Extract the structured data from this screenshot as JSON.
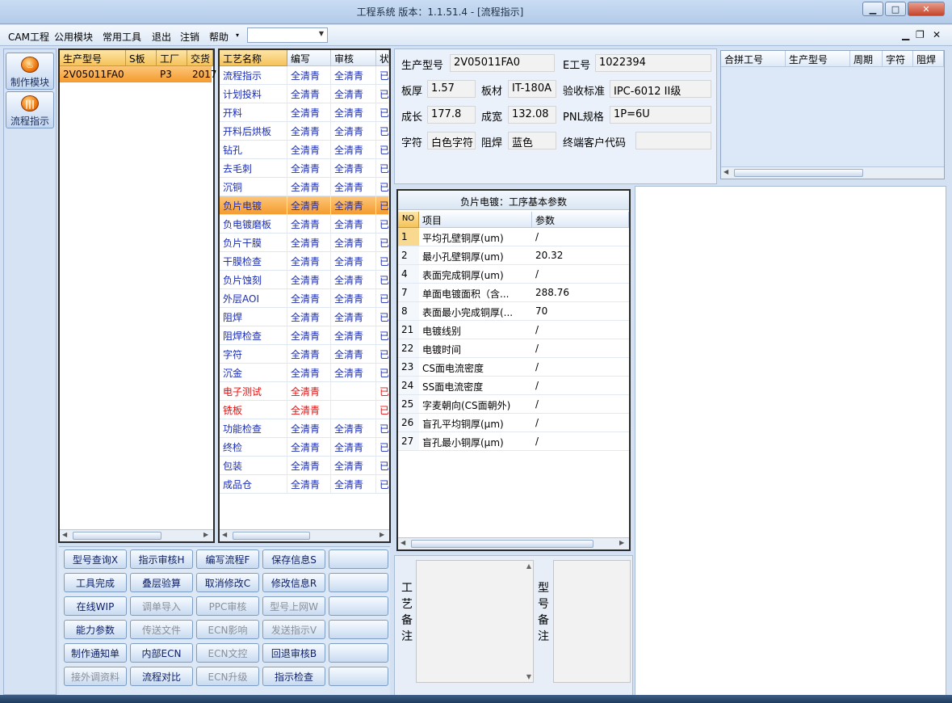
{
  "window": {
    "title": "工程系统   版本：1.1.51.4 - [流程指示]",
    "min_label": "▁",
    "max_label": "□",
    "close_label": "✕"
  },
  "menu": {
    "items": [
      "CAM工程",
      "公用模块",
      "常用工具",
      "退出",
      "注销",
      "帮助"
    ],
    "help_arrow": "▾",
    "combo_value": "",
    "mdi_min": "▁",
    "mdi_restore": "❐",
    "mdi_close": "✕"
  },
  "leftnav": {
    "items": [
      {
        "label": "制作模块",
        "icon": "fire-icon"
      },
      {
        "label": "流程指示",
        "icon": "bars-icon"
      }
    ]
  },
  "model_grid": {
    "headers": [
      "生产型号",
      "S板",
      "工厂",
      "交货"
    ],
    "rows": [
      [
        "2V05011FA0",
        "",
        "P3",
        "2017"
      ]
    ]
  },
  "process_grid": {
    "headers": [
      "工艺名称",
      "编写",
      "审核",
      "状"
    ],
    "selected": "负片电镀",
    "rows": [
      {
        "name": "流程指示",
        "write": "全清青",
        "review": "全清青",
        "status": "已",
        "red": false
      },
      {
        "name": "计划投料",
        "write": "全清青",
        "review": "全清青",
        "status": "已",
        "red": false
      },
      {
        "name": "开料",
        "write": "全清青",
        "review": "全清青",
        "status": "已",
        "red": false
      },
      {
        "name": "开料后烘板",
        "write": "全清青",
        "review": "全清青",
        "status": "已",
        "red": false
      },
      {
        "name": "钻孔",
        "write": "全清青",
        "review": "全清青",
        "status": "已",
        "red": false
      },
      {
        "name": "去毛刺",
        "write": "全清青",
        "review": "全清青",
        "status": "已",
        "red": false
      },
      {
        "name": "沉铜",
        "write": "全清青",
        "review": "全清青",
        "status": "已",
        "red": false
      },
      {
        "name": "负片电镀",
        "write": "全清青",
        "review": "全清青",
        "status": "已",
        "red": false
      },
      {
        "name": "负电镀磨板",
        "write": "全清青",
        "review": "全清青",
        "status": "已",
        "red": false
      },
      {
        "name": "负片干膜",
        "write": "全清青",
        "review": "全清青",
        "status": "已",
        "red": false
      },
      {
        "name": "干膜检查",
        "write": "全清青",
        "review": "全清青",
        "status": "已",
        "red": false
      },
      {
        "name": "负片蚀刻",
        "write": "全清青",
        "review": "全清青",
        "status": "已",
        "red": false
      },
      {
        "name": "外层AOI",
        "write": "全清青",
        "review": "全清青",
        "status": "已",
        "red": false
      },
      {
        "name": "阻焊",
        "write": "全清青",
        "review": "全清青",
        "status": "已",
        "red": false
      },
      {
        "name": "阻焊检查",
        "write": "全清青",
        "review": "全清青",
        "status": "已",
        "red": false
      },
      {
        "name": "字符",
        "write": "全清青",
        "review": "全清青",
        "status": "已",
        "red": false
      },
      {
        "name": "沉金",
        "write": "全清青",
        "review": "全清青",
        "status": "已",
        "red": false
      },
      {
        "name": "电子测试",
        "write": "全清青",
        "review": "",
        "status": "已",
        "red": true
      },
      {
        "name": "铣板",
        "write": "全清青",
        "review": "",
        "status": "已",
        "red": true
      },
      {
        "name": "功能检查",
        "write": "全清青",
        "review": "全清青",
        "status": "已",
        "red": false
      },
      {
        "name": "终检",
        "write": "全清青",
        "review": "全清青",
        "status": "已",
        "red": false
      },
      {
        "name": "包装",
        "write": "全清青",
        "review": "全清青",
        "status": "已",
        "red": false
      },
      {
        "name": "成品仓",
        "write": "全清青",
        "review": "全清青",
        "status": "已",
        "red": false
      }
    ]
  },
  "info": {
    "model_label": "生产型号",
    "model_value": "2V05011FA0",
    "eno_label": "E工号",
    "eno_value": "1022394",
    "thick_label": "板厚",
    "thick_value": "1.57",
    "mat_label": "板材",
    "mat_value": "IT-180A",
    "std_label": "验收标准",
    "std_value": "IPC-6012 II级",
    "len_label": "成长",
    "len_value": "177.8",
    "wid_label": "成宽",
    "wid_value": "132.08",
    "pnl_label": "PNL规格",
    "pnl_value": "1P=6U",
    "char_label": "字符",
    "char_value": "白色字符",
    "mask_label": "阻焊",
    "mask_value": "蓝色",
    "cust_label": "终端客户代码",
    "cust_value": ""
  },
  "combined": {
    "headers": [
      "合拼工号",
      "生产型号",
      "周期",
      "字符",
      "阻焊"
    ]
  },
  "params": {
    "title": "负片电镀：工序基本参数",
    "headers": [
      "NO",
      "项目",
      "参数"
    ],
    "rows": [
      [
        "1",
        "平均孔壁铜厚(um)",
        "/"
      ],
      [
        "2",
        "最小孔壁铜厚(um)",
        "20.32"
      ],
      [
        "4",
        "表面完成铜厚(um)",
        "/"
      ],
      [
        "7",
        "单面电镀面积（含...",
        "288.76"
      ],
      [
        "8",
        "表面最小完成铜厚(...",
        "70"
      ],
      [
        "21",
        "电镀线别",
        "/"
      ],
      [
        "22",
        "电镀时间",
        "/"
      ],
      [
        "23",
        "CS面电流密度",
        "/"
      ],
      [
        "24",
        "SS面电流密度",
        "/"
      ],
      [
        "25",
        "字麦朝向(CS面朝外)",
        "/"
      ],
      [
        "26",
        "盲孔平均铜厚(μm)",
        "/"
      ],
      [
        "27",
        "盲孔最小铜厚(μm)",
        "/"
      ]
    ]
  },
  "notes": {
    "process_label": [
      "工",
      "艺",
      "备",
      "注"
    ],
    "model_label": [
      "型",
      "号",
      "备",
      "注"
    ],
    "process_text": "",
    "model_text": ""
  },
  "actions": {
    "rows": [
      [
        {
          "label": "型号查询X",
          "on": true
        },
        {
          "label": "指示审核H",
          "on": true
        },
        {
          "label": "编写流程F",
          "on": true
        },
        {
          "label": "保存信息S",
          "on": true
        },
        {
          "label": "",
          "on": true
        }
      ],
      [
        {
          "label": "工具完成",
          "on": true
        },
        {
          "label": "叠层验算",
          "on": true
        },
        {
          "label": "取消修改C",
          "on": true
        },
        {
          "label": "修改信息R",
          "on": true
        },
        {
          "label": "",
          "on": true
        }
      ],
      [
        {
          "label": "在线WIP",
          "on": true
        },
        {
          "label": "调单导入",
          "on": false
        },
        {
          "label": "PPC审核",
          "on": false
        },
        {
          "label": "型号上网W",
          "on": false
        },
        {
          "label": "",
          "on": true
        }
      ],
      [
        {
          "label": "能力参数",
          "on": true
        },
        {
          "label": "传送文件",
          "on": false
        },
        {
          "label": "ECN影响",
          "on": false
        },
        {
          "label": "发送指示V",
          "on": false
        },
        {
          "label": "",
          "on": true
        }
      ],
      [
        {
          "label": "制作通知单",
          "on": true
        },
        {
          "label": "内部ECN",
          "on": true
        },
        {
          "label": "ECN文控",
          "on": false
        },
        {
          "label": "回退审核B",
          "on": true
        },
        {
          "label": "",
          "on": true
        }
      ],
      [
        {
          "label": "接外调资料",
          "on": false
        },
        {
          "label": "流程对比",
          "on": true
        },
        {
          "label": "ECN升级",
          "on": false
        },
        {
          "label": "指示检查",
          "on": true
        },
        {
          "label": "",
          "on": true
        }
      ]
    ]
  }
}
